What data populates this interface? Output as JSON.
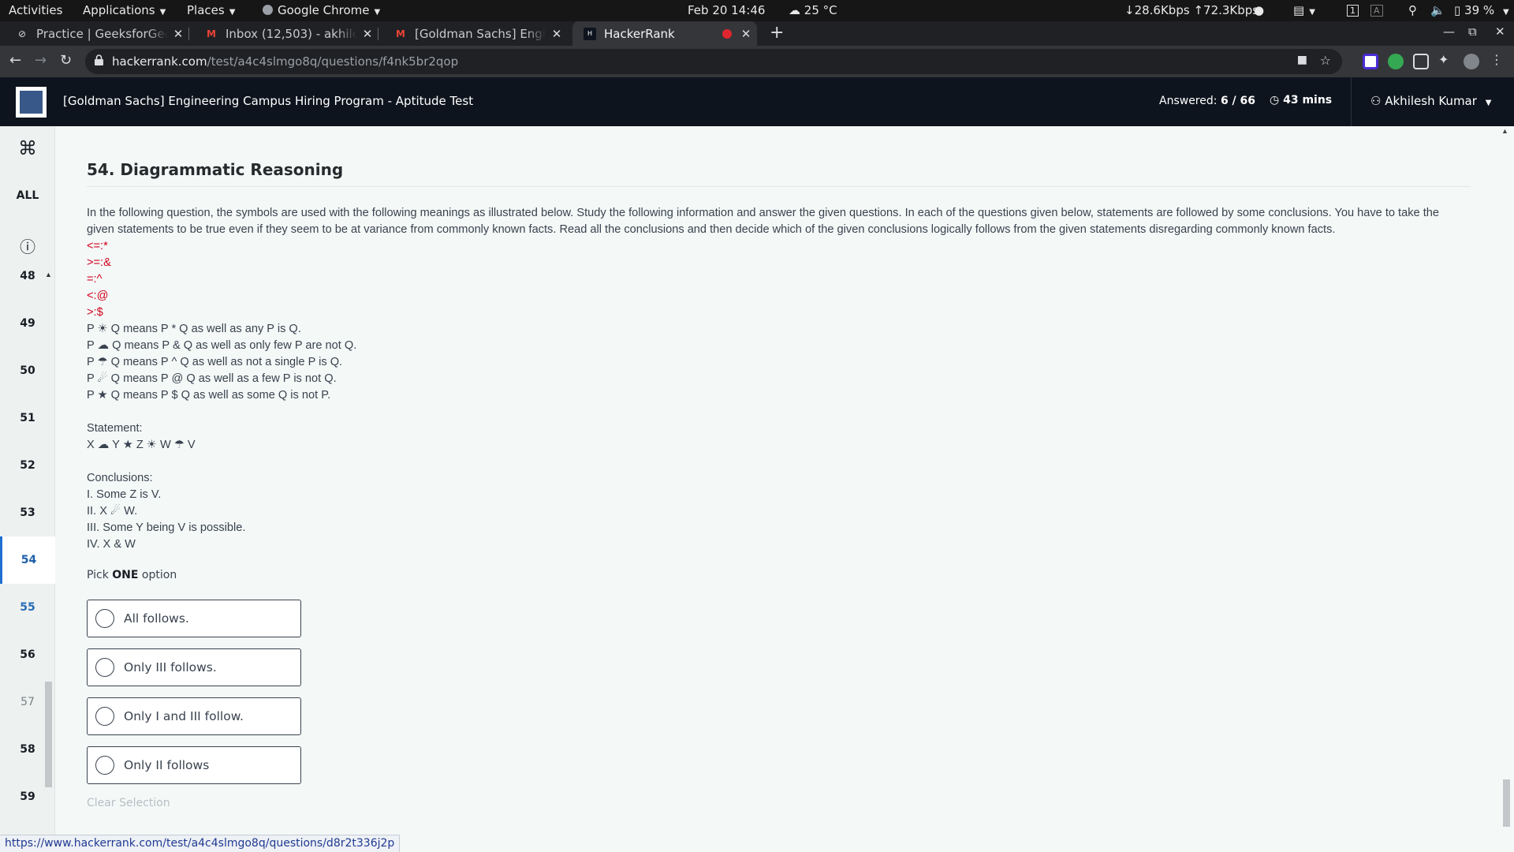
{
  "topbar": {
    "activities": "Activities",
    "applications": "Applications",
    "places": "Places",
    "chrome": "Google Chrome",
    "datetime": "Feb 20  14:46",
    "weather": "25 °C",
    "net_down": "↓28.6Kbps",
    "net_up": "↑72.3Kbps",
    "workspace": "1",
    "keyboard": "A",
    "battery": "39 %"
  },
  "tabs": [
    {
      "label": "Practice | GeeksforGeeks",
      "favicon": "geeksforgeeks-icon"
    },
    {
      "label": "Inbox (12,503) - akhileshd",
      "favicon": "gmail-icon"
    },
    {
      "label": "[Goldman Sachs] Enginee",
      "favicon": "gmail-icon"
    },
    {
      "label": "HackerRank",
      "favicon": "hackerrank-icon"
    }
  ],
  "address": {
    "host": "hackerrank.com",
    "path": "/test/a4c4slmgo8q/questions/f4nk5br2qop"
  },
  "header": {
    "title": "[Goldman Sachs] Engineering Campus Hiring Program - Aptitude Test",
    "answered_label": "Answered:",
    "answered_value": "6 / 66",
    "timer": "43 mins",
    "user": "Akhilesh Kumar"
  },
  "sidebar": {
    "shortcut_glyph": "⌘",
    "all_label": "ALL",
    "info_glyph": "ⓘ",
    "numbers": [
      "48",
      "49",
      "50",
      "51",
      "52",
      "53",
      "54",
      "55",
      "56",
      "57",
      "58",
      "59"
    ],
    "active": "54"
  },
  "question": {
    "title": "54. Diagrammatic Reasoning",
    "intro_1": "In the following question, the symbols are used with the following meanings as illustrated below. Study the following information and answer the given questions. In each of the questions given below, statements are followed by some conclusions. You have to take the",
    "intro_2": "given statements to be true even if they seem to be at variance from commonly known facts. Read all the conclusions and then decide which of the given conclusions logically follows from the given statements disregarding commonly known facts.",
    "codes": [
      "<=:*",
      ">=:&",
      "=:^",
      "<:@",
      ">:$"
    ],
    "meanings": [
      "P ☀ Q means P * Q as well as any P is Q.",
      "P ☁ Q means P & Q as well as only few P are not Q.",
      "P ☂ Q means P ^ Q as well as not a single P is Q.",
      "P ☄ Q means P @ Q as well as a few P is not Q.",
      "P ★ Q means P $ Q as well as some Q is not P."
    ],
    "statement_label": "Statement:",
    "statement": "X ☁ Y ★ Z ☀ W ☂ V",
    "conclusions_label": "Conclusions:",
    "conclusions": [
      "I. Some Z is V.",
      "II. X ☄ W.",
      "III. Some Y being V is possible.",
      "IV. X & W"
    ],
    "pick_prefix": "Pick ",
    "pick_bold": "ONE",
    "pick_suffix": " option",
    "options": [
      "All follows.",
      "Only III follows.",
      "Only I and III follow.",
      "Only II follows"
    ],
    "clear": "Clear Selection"
  },
  "status_url": "https://www.hackerrank.com/test/a4c4slmgo8q/questions/d8r2t336j2p"
}
